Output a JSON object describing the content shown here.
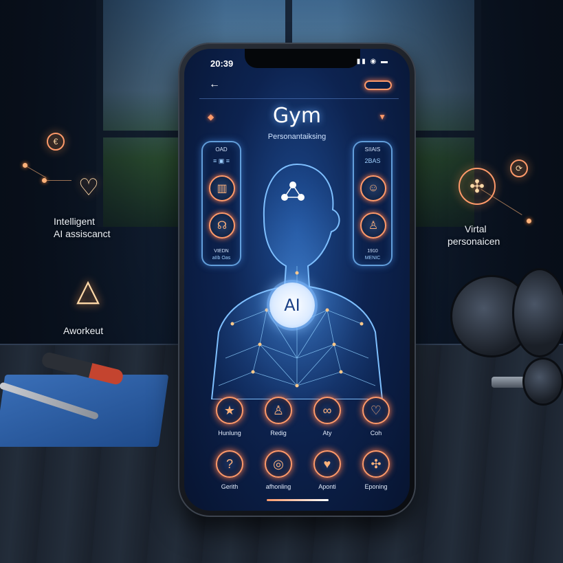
{
  "status_bar": {
    "time": "20:39",
    "icons": "▮▮ ◉ ▬"
  },
  "nav": {
    "back_icon": "arrow-left-icon",
    "back_glyph": "←",
    "menu_icon": "menu-pill-icon"
  },
  "app": {
    "title": "Gym",
    "subtitle": "Personantaiksing",
    "badge": "AI"
  },
  "panels": {
    "left": {
      "head": "OAD",
      "subhead": "≡ ▣ ≡",
      "foot": "VIEDN",
      "foot2": "aIIb Oas"
    },
    "right": {
      "head": "SIIAIS",
      "subhead": "2BAS",
      "foot": "1910",
      "foot2": "MENIC"
    }
  },
  "grid": [
    {
      "label": "Hunlung",
      "icon": "star-icon",
      "glyph": "★"
    },
    {
      "label": "Redig",
      "icon": "person-icon",
      "glyph": "♙"
    },
    {
      "label": "Aty",
      "icon": "infinity-icon",
      "glyph": "∞"
    },
    {
      "label": "Coh",
      "icon": "heart-icon",
      "glyph": "♡"
    },
    {
      "label": "Gerith",
      "icon": "question-icon",
      "glyph": "?"
    },
    {
      "label": "afhonling",
      "icon": "target-icon",
      "glyph": "◎"
    },
    {
      "label": "Aponti",
      "icon": "heart-filled-icon",
      "glyph": "♥"
    },
    {
      "label": "Eponing",
      "icon": "network-icon",
      "glyph": "✣"
    }
  ],
  "annotations": {
    "assistant_1": "Intelligent",
    "assistant_2": "AI assiscanct",
    "workout": "Aworkeut",
    "virtual_1": "Virtal",
    "virtual_2": "personaicen"
  },
  "colors": {
    "accent": "#ff9a6a",
    "glow": "#8cc4ff",
    "screen_bg": "#0d2350"
  }
}
